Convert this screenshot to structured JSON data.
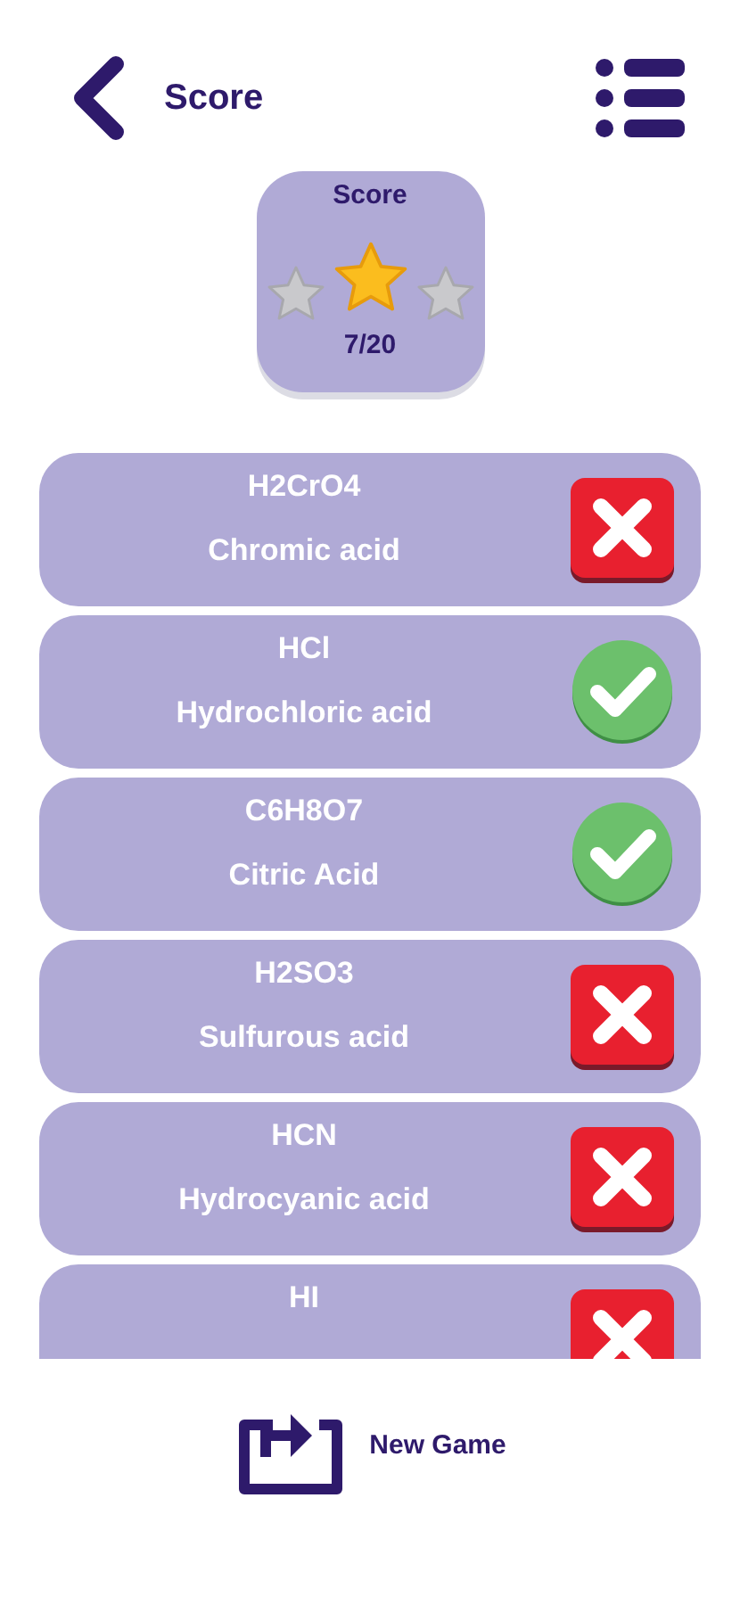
{
  "header": {
    "title": "Score"
  },
  "score_card": {
    "title": "Score",
    "stars": 1,
    "result": "7/20"
  },
  "answers": [
    {
      "formula": "H2CrO4",
      "name": "Chromic acid",
      "correct": false
    },
    {
      "formula": "HCl",
      "name": "Hydrochloric acid",
      "correct": true
    },
    {
      "formula": "C6H8O7",
      "name": "Citric Acid",
      "correct": true
    },
    {
      "formula": "H2SO3",
      "name": "Sulfurous acid",
      "correct": false
    },
    {
      "formula": "HCN",
      "name": "Hydrocyanic acid",
      "correct": false
    },
    {
      "formula": "HI",
      "correct": false
    }
  ],
  "new_game_button": {
    "label": "New Game"
  }
}
